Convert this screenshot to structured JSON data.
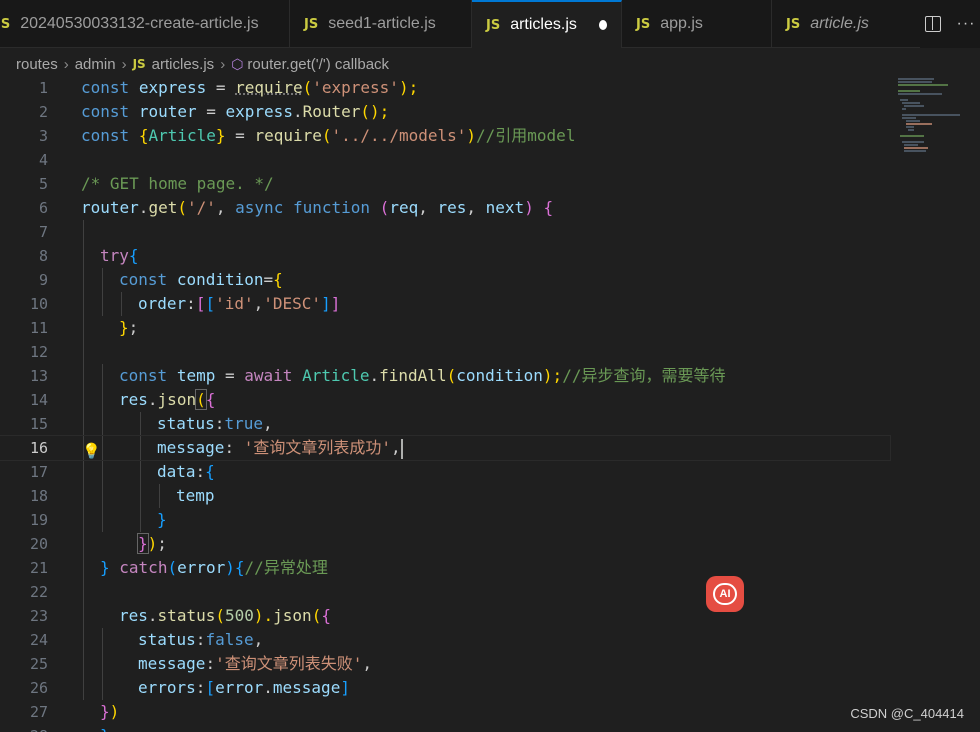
{
  "tabs": [
    {
      "icon": "JS",
      "label": "20240530033132-create-article.js"
    },
    {
      "icon": "JS",
      "label": "seed1-article.js"
    },
    {
      "icon": "JS",
      "label": "articles.js"
    },
    {
      "icon": "JS",
      "label": "app.js"
    },
    {
      "icon": "JS",
      "label": "article.js"
    }
  ],
  "breadcrumb": {
    "folder1": "routes",
    "folder2": "admin",
    "file_icon": "JS",
    "file": "articles.js",
    "symbol": "router.get('/') callback"
  },
  "code": {
    "line_numbers": [
      "1",
      "2",
      "3",
      "4",
      "5",
      "6",
      "7",
      "8",
      "9",
      "10",
      "11",
      "12",
      "13",
      "14",
      "15",
      "16",
      "17",
      "18",
      "19",
      "20",
      "21",
      "22",
      "23",
      "24",
      "25",
      "26",
      "27",
      "28"
    ],
    "t1": [
      "const",
      " ",
      "express",
      " = ",
      "require",
      "(",
      "'express'",
      ");"
    ],
    "t2": [
      "const",
      " ",
      "router",
      " = ",
      "express",
      ".",
      "Router",
      "();"
    ],
    "t3": [
      "const",
      " ",
      "{",
      "Article",
      "}",
      " = ",
      "require",
      "(",
      "'../../models'",
      ")",
      "//引用model"
    ],
    "t5": [
      "/* GET home page. */"
    ],
    "t6": [
      "router",
      ".",
      "get",
      "(",
      "'/'",
      ", ",
      "async",
      " ",
      "function",
      " ",
      "(",
      "req",
      ", ",
      "res",
      ", ",
      "next",
      ")",
      " ",
      "{"
    ],
    "t8": [
      "try",
      "{"
    ],
    "t9": [
      "const",
      " ",
      "condition",
      "=",
      "{"
    ],
    "t10": [
      "order",
      ":",
      "[",
      "[",
      "'id'",
      ",",
      "'DESC'",
      "]",
      "]"
    ],
    "t11": [
      "}",
      ";"
    ],
    "t13": [
      "const",
      " ",
      "temp",
      " = ",
      "await",
      " ",
      "Article",
      ".",
      "findAll",
      "(",
      "condition",
      ");",
      "//异步查询，需要等待"
    ],
    "t14": [
      "res",
      ".",
      "json",
      "(",
      "{"
    ],
    "t15": [
      "status",
      ":",
      "true",
      ","
    ],
    "t16": [
      "message",
      ": ",
      "'查询文章列表成功'",
      ","
    ],
    "t17": [
      "data",
      ":",
      "{"
    ],
    "t18": [
      "temp"
    ],
    "t19": [
      "}"
    ],
    "t20": [
      "}",
      ")",
      ";"
    ],
    "t21": [
      "}",
      " ",
      "catch",
      "(",
      "error",
      ")",
      "{",
      "//异常处理"
    ],
    "t23": [
      "res",
      ".",
      "status",
      "(",
      "500",
      ").",
      "json",
      "(",
      "{"
    ],
    "t24": [
      "status",
      ":",
      "false",
      ","
    ],
    "t25": [
      "message",
      ":",
      "'查询文章列表失败'",
      ","
    ],
    "t26": [
      "errors",
      ":",
      "[",
      "error",
      ".",
      "message",
      "]"
    ],
    "t27": [
      "}",
      ")"
    ],
    "t28": [
      "}"
    ]
  },
  "ai_badge": {
    "label": "AI"
  },
  "watermark": "CSDN @C_404414",
  "colors": {
    "accent": "#0078d4",
    "editor_bg": "#1f1f1f",
    "tab_bg": "#181818",
    "js_icon": "#cbcb41"
  }
}
